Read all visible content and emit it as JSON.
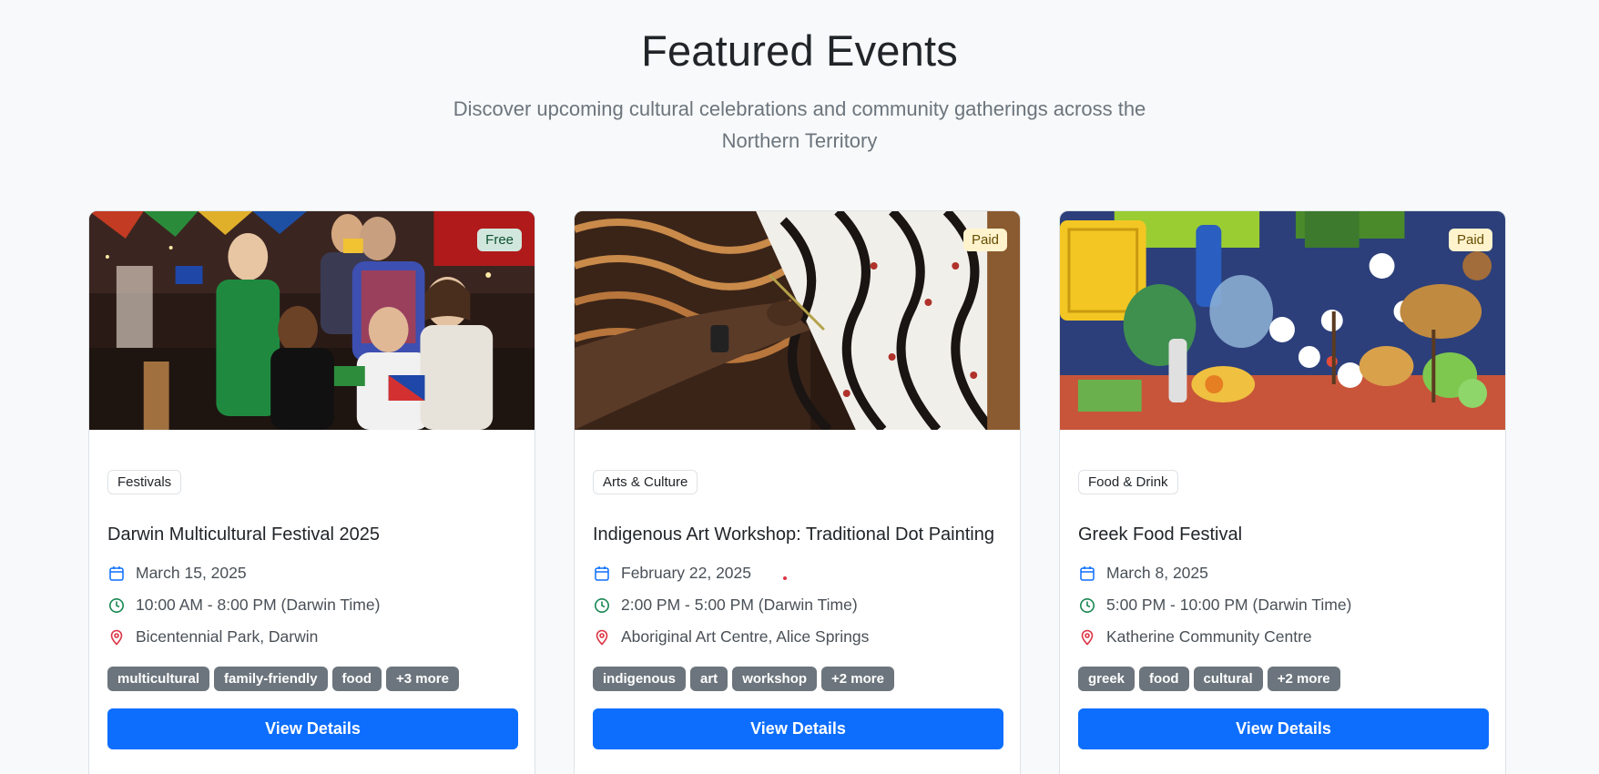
{
  "section": {
    "title": "Featured Events",
    "subtitle": "Discover upcoming cultural celebrations and community gatherings across the Northern Territory"
  },
  "icons": {
    "date": "calendar-icon",
    "time": "clock-icon",
    "location": "map-pin-icon"
  },
  "colors": {
    "primary": "#0d6efd",
    "calendar_icon": "#0d6efd",
    "clock_icon": "#198754",
    "pin_icon": "#dc3545",
    "tag_bg": "#6c757d",
    "free_badge_bg": "#d1e7dd",
    "paid_badge_bg": "#fff3cd"
  },
  "events": [
    {
      "price": "Free",
      "category": "Festivals",
      "title": "Darwin Multicultural Festival 2025",
      "date": "March 15, 2025",
      "time": "10:00 AM - 8:00 PM (Darwin Time)",
      "location": "Bicentennial Park, Darwin",
      "tags": [
        "multicultural",
        "family-friendly",
        "food",
        "+3 more"
      ],
      "button": "View Details"
    },
    {
      "price": "Paid",
      "category": "Arts & Culture",
      "title": "Indigenous Art Workshop: Traditional Dot Painting",
      "date": "February 22, 2025",
      "time": "2:00 PM - 5:00 PM (Darwin Time)",
      "location": "Aboriginal Art Centre, Alice Springs",
      "tags": [
        "indigenous",
        "art",
        "workshop",
        "+2 more"
      ],
      "button": "View Details"
    },
    {
      "price": "Paid",
      "category": "Food & Drink",
      "title": "Greek Food Festival",
      "date": "March 8, 2025",
      "time": "5:00 PM - 10:00 PM (Darwin Time)",
      "location": "Katherine Community Centre",
      "tags": [
        "greek",
        "food",
        "cultural",
        "+2 more"
      ],
      "button": "View Details"
    }
  ]
}
